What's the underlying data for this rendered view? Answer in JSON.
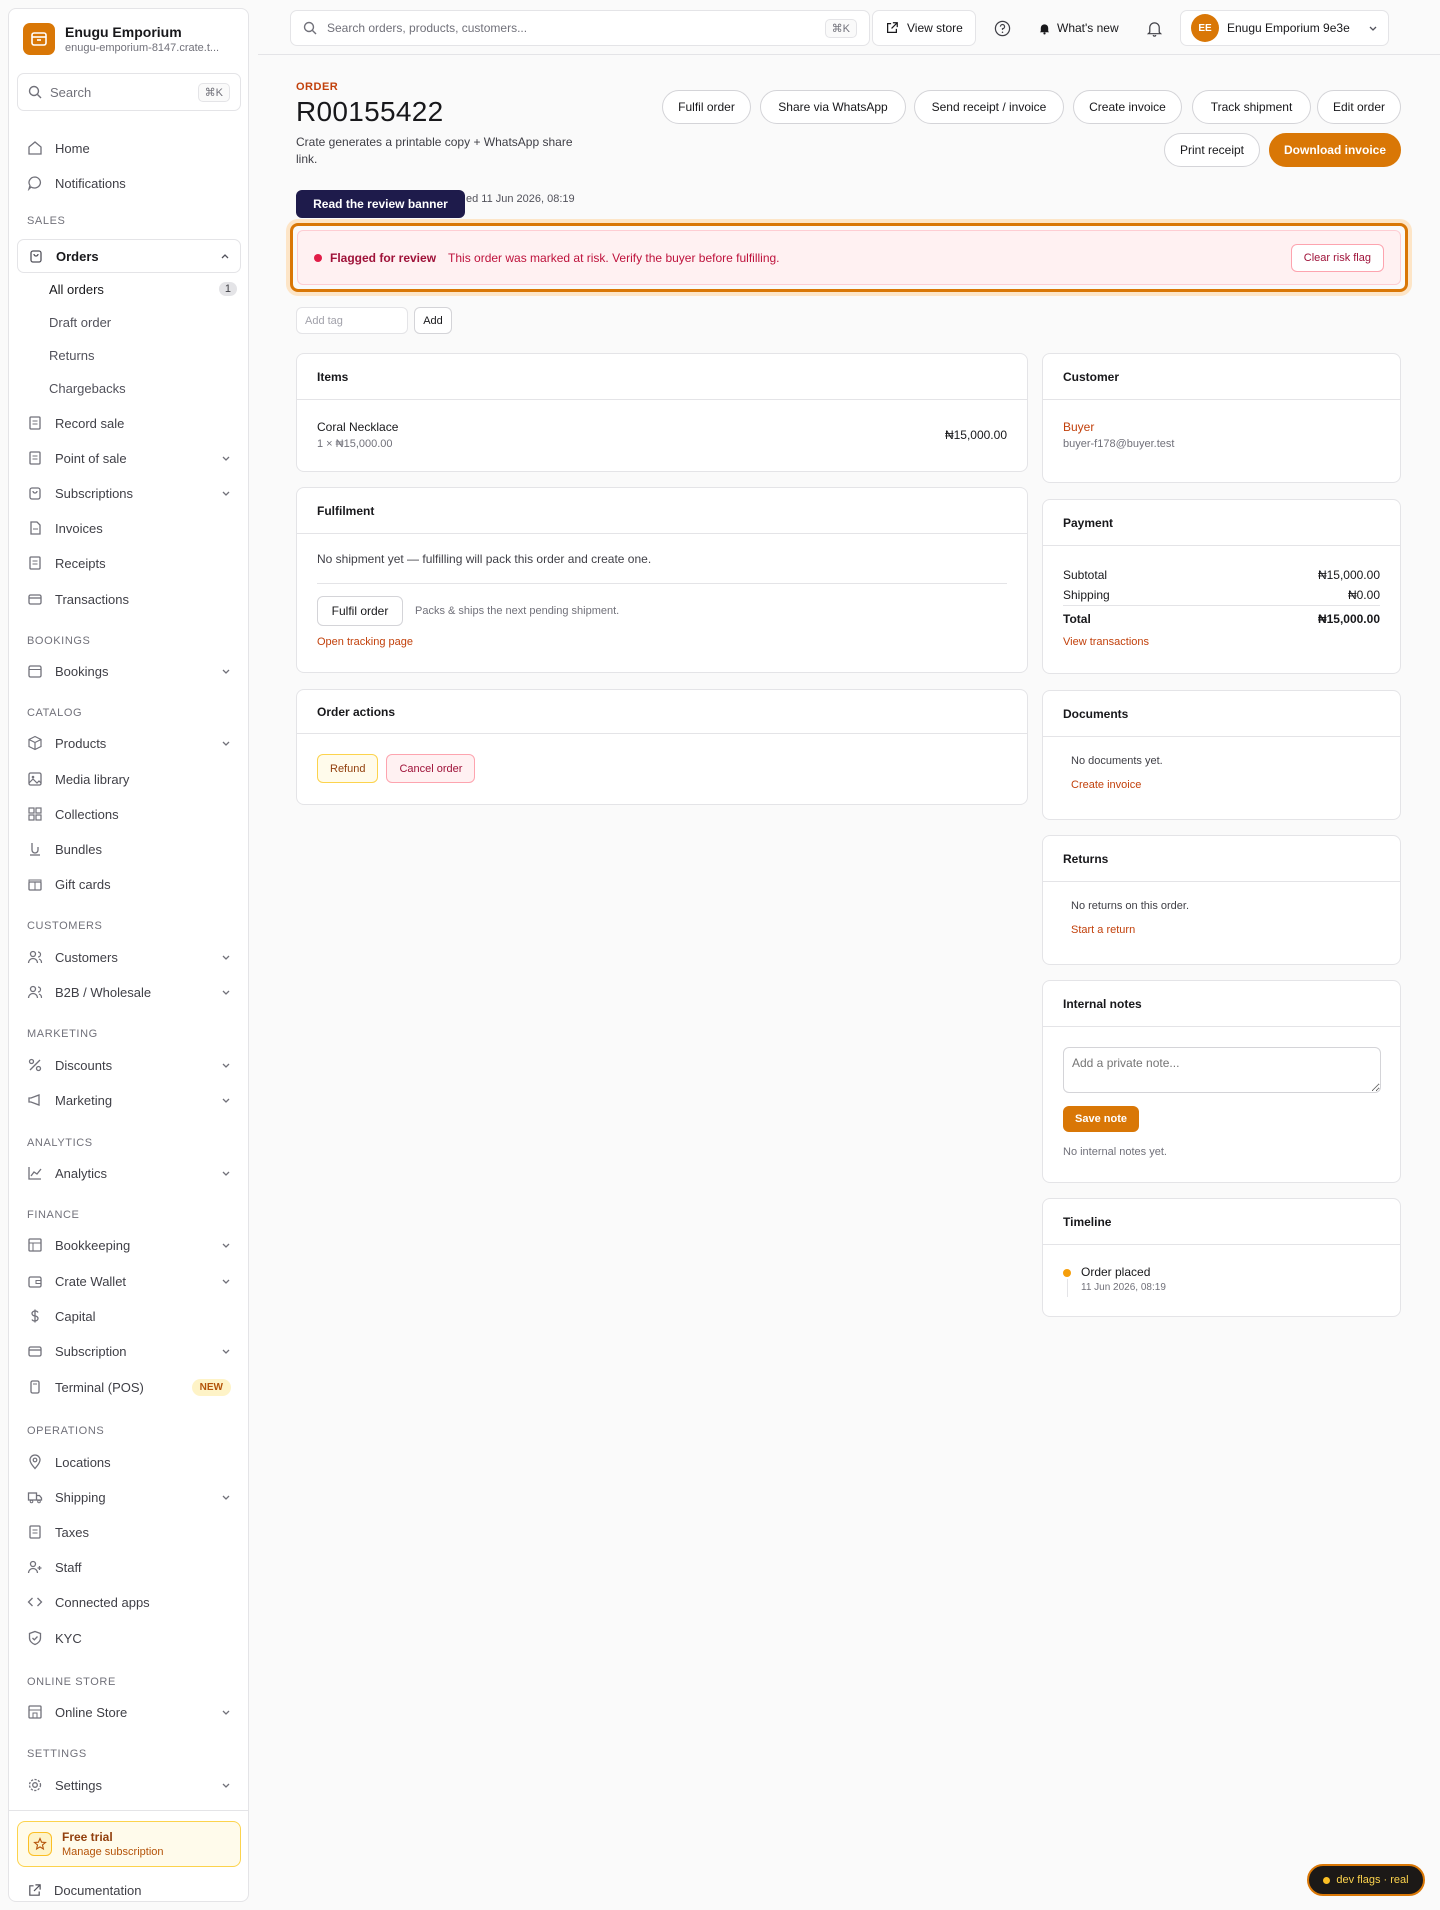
{
  "brand": {
    "name": "Enugu Emporium",
    "url": "enugu-emporium-8147.crate.t...",
    "logo_color": "#d97706"
  },
  "sidebar": {
    "search": {
      "placeholder": "Search",
      "shortcut": "⌘K"
    },
    "home": "Home",
    "notifications": "Notifications",
    "sections": {
      "sales": "SALES",
      "bookings": "BOOKINGS",
      "catalog": "CATALOG",
      "customers": "CUSTOMERS",
      "marketing": "MARKETING",
      "analytics": "ANALYTICS",
      "finance": "FINANCE",
      "operations": "OPERATIONS",
      "online_store": "ONLINE STORE",
      "settings": "SETTINGS"
    },
    "orders": {
      "label": "Orders",
      "sub": [
        {
          "label": "All orders",
          "count": "1"
        },
        {
          "label": "Draft order"
        },
        {
          "label": "Returns"
        },
        {
          "label": "Chargebacks"
        }
      ]
    },
    "sales_items": [
      "Record sale",
      "Point of sale",
      "Subscriptions",
      "Invoices",
      "Receipts",
      "Transactions"
    ],
    "bookings": "Bookings",
    "catalog_items": [
      "Products",
      "Media library",
      "Collections",
      "Bundles",
      "Gift cards"
    ],
    "customer_items": [
      "Customers",
      "B2B / Wholesale"
    ],
    "marketing_items": [
      "Discounts",
      "Marketing"
    ],
    "analytics": "Analytics",
    "finance_items": [
      "Bookkeeping",
      "Crate Wallet",
      "Capital",
      "Subscription",
      "Terminal (POS)"
    ],
    "new_badge": "NEW",
    "operations_items": [
      "Locations",
      "Shipping",
      "Taxes",
      "Staff",
      "Connected apps",
      "KYC"
    ],
    "online_store": "Online Store",
    "settings": "Settings",
    "trial": {
      "title": "Free trial",
      "subtitle": "Manage subscription"
    },
    "documentation": "Documentation"
  },
  "topbar": {
    "search_placeholder": "Search orders, products, customers...",
    "search_shortcut": "⌘K",
    "view_store": "View store",
    "whats_new": "What's new",
    "account": {
      "initials": "EE",
      "name": "Enugu Emporium 9e3e"
    }
  },
  "order": {
    "eyebrow": "ORDER",
    "number": "R00155422",
    "subtitle": "Crate generates a printable copy + WhatsApp share link.",
    "placed": "ed 11 Jun 2026, 08:19",
    "actions": [
      "Fulfil order",
      "Share via WhatsApp",
      "Send receipt / invoice",
      "Create invoice",
      "Track shipment",
      "Edit order"
    ],
    "print_receipt": "Print receipt",
    "download_invoice": "Download invoice"
  },
  "tooltip": "Read the review banner",
  "banner": {
    "title": "Flagged for review",
    "message": "This order was marked at risk. Verify the buyer before fulfilling.",
    "button": "Clear risk flag"
  },
  "tags": {
    "placeholder": "Add tag",
    "add": "Add"
  },
  "items": {
    "title": "Items",
    "product": "Coral Necklace",
    "qty_price": "1 × ₦15,000.00",
    "total": "₦15,000.00"
  },
  "fulfilment": {
    "title": "Fulfilment",
    "message": "No shipment yet — fulfilling will pack this order and create one.",
    "button": "Fulfil order",
    "hint": "Packs & ships the next pending shipment.",
    "link": "Open tracking page"
  },
  "order_actions": {
    "title": "Order actions",
    "refund": "Refund",
    "cancel": "Cancel order"
  },
  "customer": {
    "title": "Customer",
    "name": "Buyer",
    "email": "buyer-f178@buyer.test"
  },
  "payment": {
    "title": "Payment",
    "subtotal_label": "Subtotal",
    "subtotal": "₦15,000.00",
    "shipping_label": "Shipping",
    "shipping": "₦0.00",
    "total_label": "Total",
    "total": "₦15,000.00",
    "link": "View transactions"
  },
  "documents": {
    "title": "Documents",
    "empty": "No documents yet.",
    "link": "Create invoice"
  },
  "returns": {
    "title": "Returns",
    "empty": "No returns on this order.",
    "link": "Start a return"
  },
  "notes": {
    "title": "Internal notes",
    "placeholder": "Add a private note...",
    "save": "Save note",
    "empty": "No internal notes yet."
  },
  "timeline": {
    "title": "Timeline",
    "event": "Order placed",
    "date": "11 Jun 2026, 08:19"
  },
  "dev_flags": "dev flags · real",
  "colors": {
    "accent": "#d97706",
    "danger": "#e11d48",
    "link": "#c2410c"
  }
}
